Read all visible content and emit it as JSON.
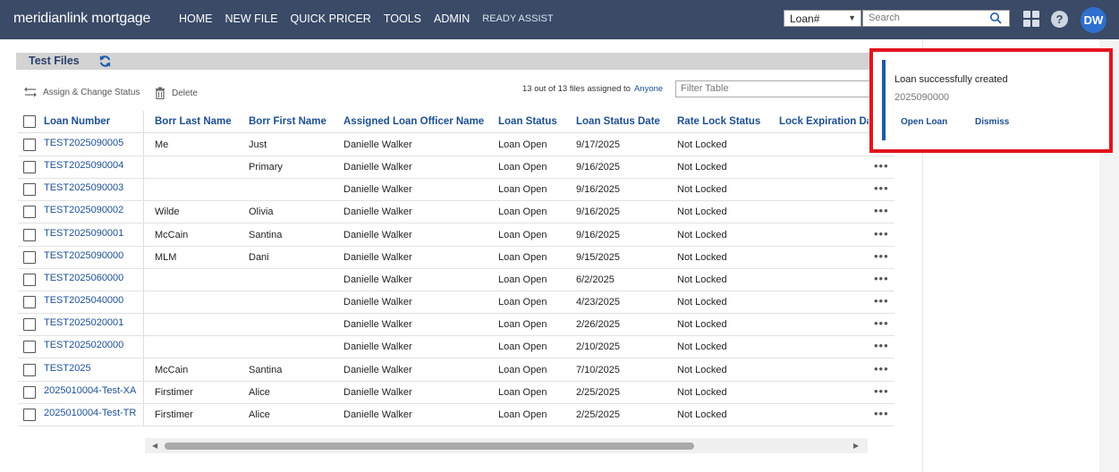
{
  "header": {
    "logo_text": "meridianlink mortgage",
    "nav": [
      {
        "label": "HOME"
      },
      {
        "label": "NEW FILE"
      },
      {
        "label": "QUICK PRICER"
      },
      {
        "label": "TOOLS"
      },
      {
        "label": "ADMIN"
      },
      {
        "label": "READY ASSIST"
      }
    ],
    "search_type": "Loan#",
    "search_placeholder": "Search",
    "user_initials": "DW",
    "help_label": "?",
    "colors": {
      "bar": "#3a4a67",
      "avatar": "#2e6fcf"
    }
  },
  "section": {
    "title": "Test Files"
  },
  "toolbar": {
    "assign_label": "Assign & Change Status",
    "delete_label": "Delete",
    "count_text": "13 out of 13 files assigned to",
    "assignee_link": "Anyone",
    "filter_placeholder": "Filter Table"
  },
  "table": {
    "columns": [
      "Loan Number",
      "Borr Last Name",
      "Borr First Name",
      "Assigned Loan Officer Name",
      "Loan Status",
      "Loan Status Date",
      "Rate Lock Status",
      "Lock Expiration Date"
    ],
    "rows": [
      {
        "loan": "TEST2025090005",
        "last": "Me",
        "first": "Just",
        "officer": "Danielle Walker",
        "status": "Loan Open",
        "date": "9/17/2025",
        "lock": "Not Locked"
      },
      {
        "loan": "TEST2025090004",
        "last": "",
        "first": "Primary",
        "officer": "Danielle Walker",
        "status": "Loan Open",
        "date": "9/16/2025",
        "lock": "Not Locked"
      },
      {
        "loan": "TEST2025090003",
        "last": "",
        "first": "",
        "officer": "Danielle Walker",
        "status": "Loan Open",
        "date": "9/16/2025",
        "lock": "Not Locked"
      },
      {
        "loan": "TEST2025090002",
        "last": "Wilde",
        "first": "Olivia",
        "officer": "Danielle Walker",
        "status": "Loan Open",
        "date": "9/16/2025",
        "lock": "Not Locked"
      },
      {
        "loan": "TEST2025090001",
        "last": "McCain",
        "first": "Santina",
        "officer": "Danielle Walker",
        "status": "Loan Open",
        "date": "9/16/2025",
        "lock": "Not Locked"
      },
      {
        "loan": "TEST2025090000",
        "last": "MLM",
        "first": "Dani",
        "officer": "Danielle Walker",
        "status": "Loan Open",
        "date": "9/15/2025",
        "lock": "Not Locked"
      },
      {
        "loan": "TEST2025060000",
        "last": "",
        "first": "",
        "officer": "Danielle Walker",
        "status": "Loan Open",
        "date": "6/2/2025",
        "lock": "Not Locked"
      },
      {
        "loan": "TEST2025040000",
        "last": "",
        "first": "",
        "officer": "Danielle Walker",
        "status": "Loan Open",
        "date": "4/23/2025",
        "lock": "Not Locked"
      },
      {
        "loan": "TEST2025020001",
        "last": "",
        "first": "",
        "officer": "Danielle Walker",
        "status": "Loan Open",
        "date": "2/26/2025",
        "lock": "Not Locked"
      },
      {
        "loan": "TEST2025020000",
        "last": "",
        "first": "",
        "officer": "Danielle Walker",
        "status": "Loan Open",
        "date": "2/10/2025",
        "lock": "Not Locked"
      },
      {
        "loan": "TEST2025",
        "last": "McCain",
        "first": "Santina",
        "officer": "Danielle Walker",
        "status": "Loan Open",
        "date": "7/10/2025",
        "lock": "Not Locked"
      },
      {
        "loan": "2025010004-Test-XA",
        "last": "Firstimer",
        "first": "Alice",
        "officer": "Danielle Walker",
        "status": "Loan Open",
        "date": "2/25/2025",
        "lock": "Not Locked"
      },
      {
        "loan": "2025010004-Test-TR",
        "last": "Firstimer",
        "first": "Alice",
        "officer": "Danielle Walker",
        "status": "Loan Open",
        "date": "2/25/2025",
        "lock": "Not Locked"
      }
    ],
    "more_label": "•••"
  },
  "toast": {
    "title": "Loan successfully created",
    "loan_number": "2025090000",
    "open_label": "Open Loan",
    "dismiss_label": "Dismiss",
    "highlight_color": "#e3141d"
  }
}
